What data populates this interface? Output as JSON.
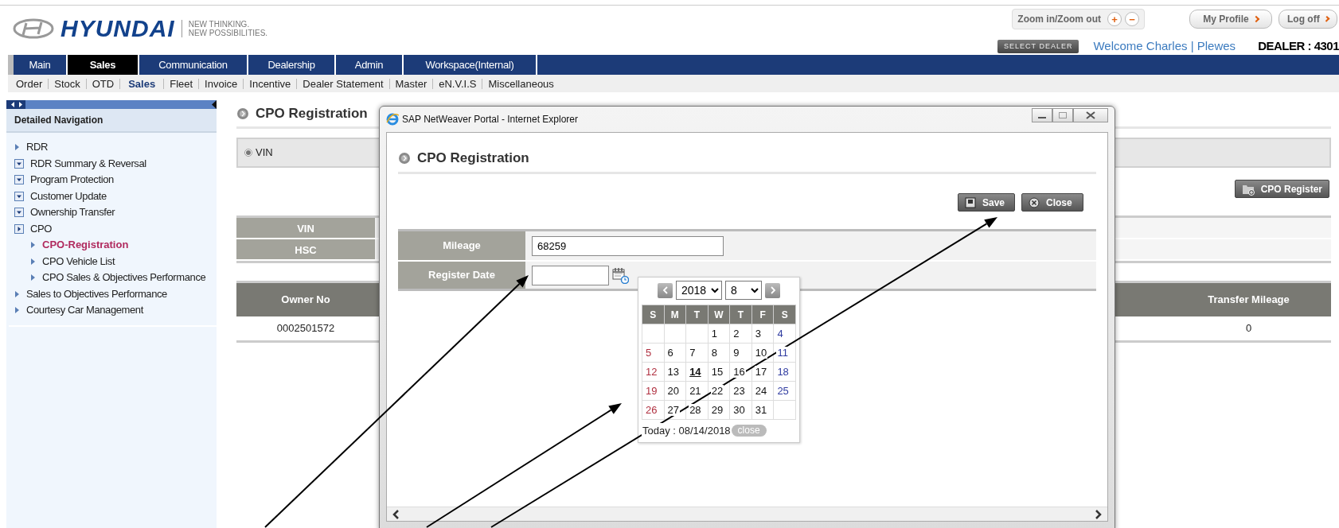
{
  "header": {
    "brand": "HYUNDAI",
    "tagline": [
      "NEW THINKING.",
      "NEW POSSIBILITIES."
    ],
    "zoom_label": "Zoom in/Zoom out",
    "zoom_in": "+",
    "zoom_out": "−",
    "profile": "My Profile",
    "logoff": "Log off",
    "select_dealer": "SELECT DEALER",
    "welcome": "Welcome Charles | Plewes",
    "dealer": "DEALER : 4301"
  },
  "main_tabs": [
    {
      "label": "Main",
      "selected": false
    },
    {
      "label": "Sales",
      "selected": true
    },
    {
      "label": "Communication",
      "selected": false
    },
    {
      "label": "Dealership",
      "selected": false
    },
    {
      "label": "Admin",
      "selected": false
    },
    {
      "label": "Workspace(Internal)",
      "selected": false
    }
  ],
  "sub_tabs": [
    {
      "label": "Order",
      "selected": false
    },
    {
      "label": "Stock",
      "selected": false
    },
    {
      "label": "OTD",
      "selected": false
    },
    {
      "label": "Sales",
      "selected": true
    },
    {
      "label": "Fleet",
      "selected": false
    },
    {
      "label": "Invoice",
      "selected": false
    },
    {
      "label": "Incentive",
      "selected": false
    },
    {
      "label": "Dealer Statement",
      "selected": false
    },
    {
      "label": "Master",
      "selected": false
    },
    {
      "label": "eN.V.I.S",
      "selected": false
    },
    {
      "label": "Miscellaneous",
      "selected": false
    }
  ],
  "sidebar": {
    "title": "Detailed Navigation",
    "items": [
      {
        "label": "RDR",
        "kind": "arrow",
        "selected": false
      },
      {
        "label": "RDR Summary & Reversal",
        "kind": "collapse",
        "selected": false
      },
      {
        "label": "Program Protection",
        "kind": "collapse",
        "selected": false
      },
      {
        "label": "Customer Update",
        "kind": "collapse",
        "selected": false
      },
      {
        "label": "Ownership Transfer",
        "kind": "collapse",
        "selected": false
      },
      {
        "label": "CPO",
        "kind": "expand",
        "selected": false,
        "children": [
          {
            "label": "CPO-Registration",
            "kind": "arrow",
            "selected": true
          },
          {
            "label": "CPO Vehicle List",
            "kind": "arrow",
            "selected": false
          },
          {
            "label": "CPO Sales & Objectives Performance",
            "kind": "arrow",
            "selected": false
          }
        ]
      },
      {
        "label": "Sales to Objectives Performance",
        "kind": "arrow",
        "selected": false
      },
      {
        "label": "Courtesy Car Management",
        "kind": "arrow",
        "selected": false
      }
    ]
  },
  "page": {
    "title": "CPO Registration",
    "search_option": {
      "label": "VIN",
      "selected": true
    },
    "register_button": "CPO Register",
    "info_rows": [
      "VIN",
      "HSC"
    ],
    "owner_table": {
      "columns": [
        "Owner No",
        "Transfer Mileage"
      ],
      "rows": [
        [
          "0002501572",
          "0"
        ]
      ]
    }
  },
  "dialog": {
    "window_title": "SAP NetWeaver Portal - Internet Explorer",
    "title": "CPO Registration",
    "buttons": [
      {
        "label": "Save",
        "kind": "save"
      },
      {
        "label": "Close",
        "kind": "close"
      }
    ],
    "fields": [
      {
        "label": "Mileage",
        "kind": "text",
        "value": "68259"
      },
      {
        "label": "Register Date",
        "kind": "date"
      }
    ],
    "calendar": {
      "year": "2018",
      "month": "8",
      "weekdays": [
        "S",
        "M",
        "T",
        "W",
        "T",
        "F",
        "S"
      ],
      "weeks": [
        [
          {
            "kind": "blank"
          },
          {
            "kind": "blank"
          },
          {
            "kind": "blank"
          },
          {
            "d": "1",
            "today": false
          },
          {
            "d": "2",
            "today": false
          },
          {
            "d": "3",
            "today": false
          },
          {
            "d": "4",
            "today": false
          }
        ],
        [
          {
            "d": "5",
            "today": false
          },
          {
            "d": "6",
            "today": false
          },
          {
            "d": "7",
            "today": false
          },
          {
            "d": "8",
            "today": false
          },
          {
            "d": "9",
            "today": false
          },
          {
            "d": "10",
            "today": false
          },
          {
            "d": "11",
            "today": false
          }
        ],
        [
          {
            "d": "12",
            "today": false
          },
          {
            "d": "13",
            "today": false
          },
          {
            "d": "14",
            "today": true
          },
          {
            "d": "15",
            "today": false
          },
          {
            "d": "16",
            "today": false
          },
          {
            "d": "17",
            "today": false
          },
          {
            "d": "18",
            "today": false
          }
        ],
        [
          {
            "d": "19",
            "today": false
          },
          {
            "d": "20",
            "today": false
          },
          {
            "d": "21",
            "today": false
          },
          {
            "d": "22",
            "today": false
          },
          {
            "d": "23",
            "today": false
          },
          {
            "d": "24",
            "today": false
          },
          {
            "d": "25",
            "today": false
          }
        ],
        [
          {
            "d": "26",
            "today": false
          },
          {
            "d": "27",
            "today": false
          },
          {
            "d": "28",
            "today": false
          },
          {
            "d": "29",
            "today": false
          },
          {
            "d": "30",
            "today": false
          },
          {
            "d": "31",
            "today": false
          },
          {
            "kind": "blank"
          }
        ]
      ],
      "today_text": "Today : 08/14/2018",
      "close": "close"
    }
  }
}
